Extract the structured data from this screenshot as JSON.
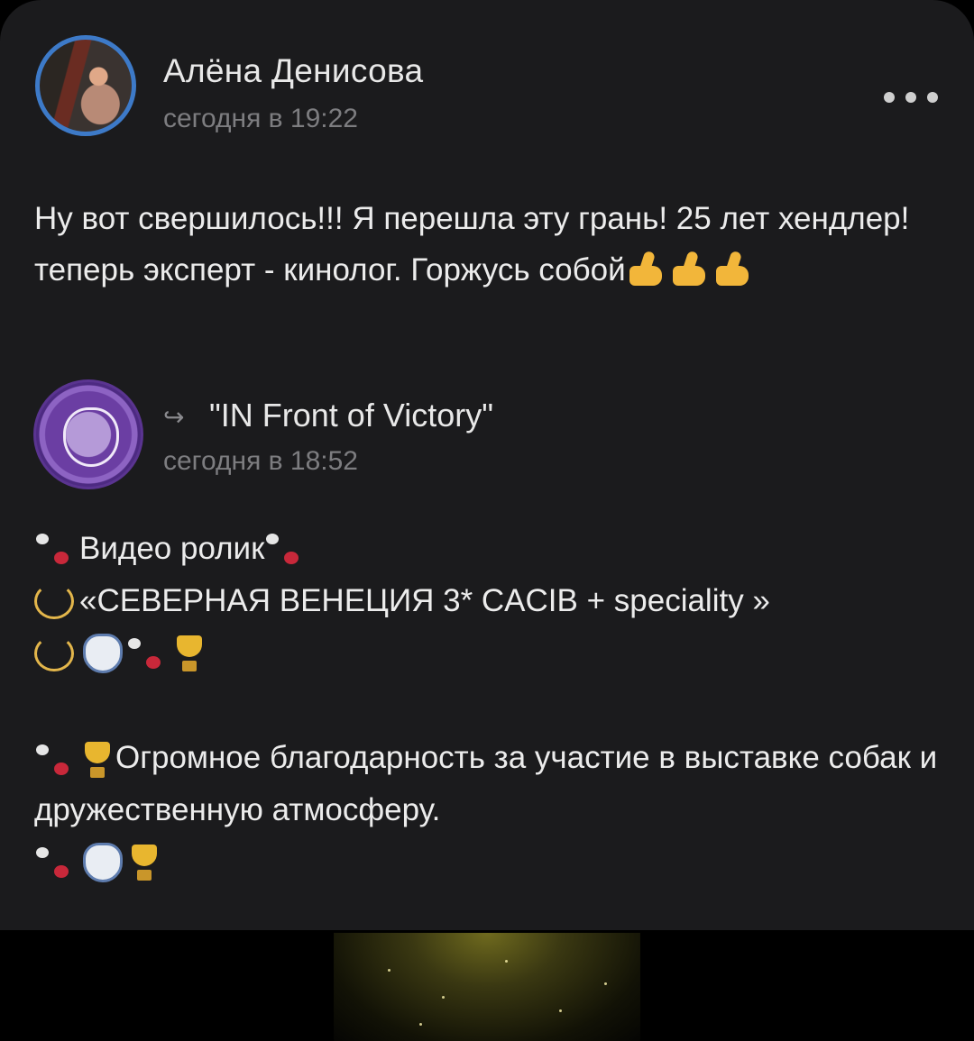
{
  "post": {
    "author_name": "Алёна Денисова",
    "timestamp": "сегодня в 19:22",
    "more_label": "more",
    "text": "Ну вот свершилось!!! Я перешла эту грань! 25 лет хендлер! теперь эксперт - кинолог. Горжусь собой",
    "emoji": [
      "thumbs-up",
      "thumbs-up",
      "thumbs-up"
    ]
  },
  "repost": {
    "group_name": "\"IN Front of Victory\"",
    "timestamp": "сегодня в 18:52",
    "repost_icon": "↪",
    "lines": {
      "l1": "Видео ролик",
      "l2": "«СЕВЕРНАЯ ВЕНЕЦИЯ 3* CACIB + speciality »",
      "l4": "Огромное благодарность за участие в выставке собак и дружественную атмосферу."
    }
  },
  "colors": {
    "background": "#000000",
    "card": "#1b1b1d",
    "text": "#ececec",
    "muted": "#7d7d80",
    "avatar_ring": "#3d7ac8"
  }
}
